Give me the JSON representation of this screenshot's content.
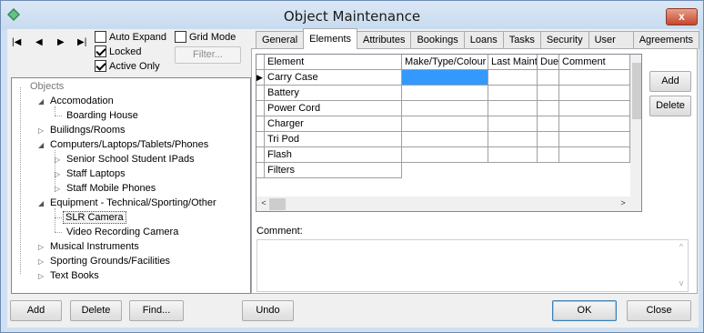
{
  "window": {
    "title": "Object Maintenance",
    "close_glyph": "x"
  },
  "nav": {
    "first": "|◀",
    "prev": "◀",
    "next": "▶",
    "last": "▶|"
  },
  "options": {
    "auto_expand": {
      "label": "Auto Expand",
      "checked": false
    },
    "locked": {
      "label": "Locked",
      "checked": true
    },
    "active_only": {
      "label": "Active Only",
      "checked": true
    },
    "grid_mode": {
      "label": "Grid Mode",
      "checked": false
    },
    "filter_label": "Filter..."
  },
  "tree": {
    "root": "Objects",
    "accomodation": "Accomodation",
    "boarding_house": "Boarding House",
    "buildings": "Builidngs/Rooms",
    "computers": "Computers/Laptops/Tablets/Phones",
    "ipads": "Senior School Student IPads",
    "laptops": "Staff Laptops",
    "mobiles": "Staff Mobile Phones",
    "equipment": "Equipment - Technical/Sporting/Other",
    "slr": "SLR Camera",
    "video": "Video Recording Camera",
    "musical": "Musical Instruments",
    "sporting": "Sporting Grounds/Facilities",
    "textbooks": "Text Books"
  },
  "tabs": [
    "General",
    "Elements",
    "Attributes",
    "Bookings",
    "Loans",
    "Tasks",
    "Security",
    "User Forms",
    "Agreements"
  ],
  "active_tab": "Elements",
  "grid": {
    "headers": [
      "Element",
      "Make/Type/Colour",
      "Last Maint",
      "Due",
      "Comment"
    ],
    "rows": [
      "Carry Case",
      "Battery",
      "Power Cord",
      "Charger",
      "Tri Pod",
      "Flash",
      "Filters"
    ],
    "current_row_marker": "▶"
  },
  "side_buttons": {
    "add": "Add",
    "delete": "Delete"
  },
  "comment_label": "Comment:",
  "bottom": {
    "add": "Add",
    "delete": "Delete",
    "find": "Find...",
    "undo": "Undo",
    "ok": "OK",
    "close": "Close"
  },
  "scroll_arrows": {
    "left": "<",
    "right": ">",
    "up": "^",
    "down": "v"
  }
}
